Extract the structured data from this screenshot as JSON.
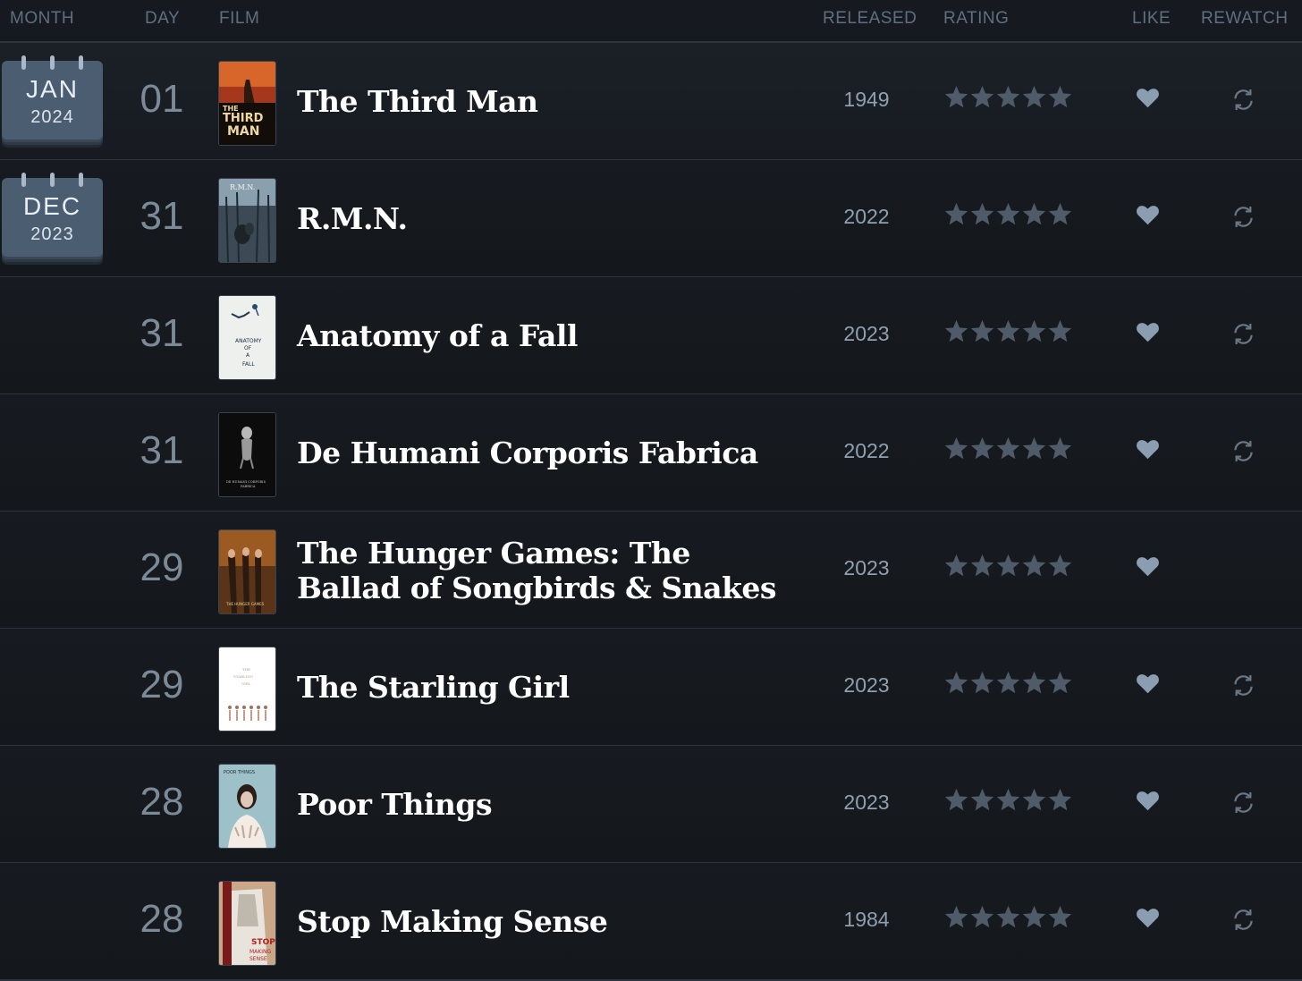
{
  "header": {
    "month": "MONTH",
    "day": "DAY",
    "film": "FILM",
    "released": "RELEASED",
    "rating": "RATING",
    "like": "LIKE",
    "rewatch": "REWATCH"
  },
  "entries": [
    {
      "month": "JAN",
      "year": "2024",
      "day": "01",
      "title": "The Third Man",
      "released": "1949",
      "rating": 5,
      "liked": true,
      "rewatch": true,
      "poster_text": "THE THIRD MAN"
    },
    {
      "month": "DEC",
      "year": "2023",
      "day": "31",
      "title": "R.M.N.",
      "released": "2022",
      "rating": 5,
      "liked": true,
      "rewatch": true,
      "poster_text": "R.M.N."
    },
    {
      "day": "31",
      "title": "Anatomy of a Fall",
      "released": "2023",
      "rating": 5,
      "liked": true,
      "rewatch": true,
      "poster_text": "ANATOMY OF A FALL"
    },
    {
      "day": "31",
      "title": "De Humani Corporis Fabrica",
      "released": "2022",
      "rating": 5,
      "liked": true,
      "rewatch": true,
      "poster_text": "DE HUMANI CORPORIS FABRICA"
    },
    {
      "day": "29",
      "title": "The Hunger Games: The Ballad of Songbirds & Snakes",
      "released": "2023",
      "rating": 5,
      "liked": true,
      "rewatch": false,
      "poster_text": "THE HUNGER GAMES"
    },
    {
      "day": "29",
      "title": "The Starling Girl",
      "released": "2023",
      "rating": 5,
      "liked": true,
      "rewatch": true,
      "poster_text": "THE STARLING GIRL"
    },
    {
      "day": "28",
      "title": "Poor Things",
      "released": "2023",
      "rating": 5,
      "liked": true,
      "rewatch": true,
      "poster_text": "POOR THINGS"
    },
    {
      "day": "28",
      "title": "Stop Making Sense",
      "released": "1984",
      "rating": 5,
      "liked": true,
      "rewatch": true,
      "poster_text": "STOP MAKING SENSE"
    }
  ],
  "colors": {
    "background": "#14181c",
    "star": "#4f5b68",
    "heart": "#8a9db1",
    "rewatch": "#6a7886",
    "calendar": "#4b5d70"
  }
}
